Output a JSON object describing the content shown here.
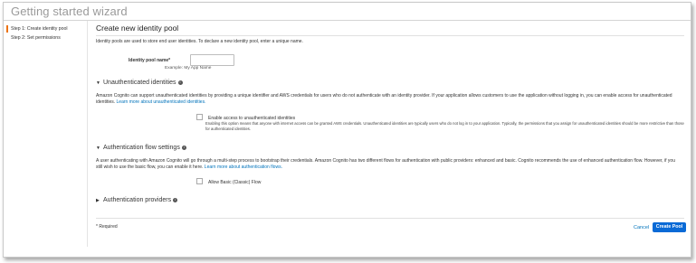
{
  "wizard_title": "Getting started wizard",
  "steps": [
    {
      "label": "Step 1: Create identity pool",
      "active": true
    },
    {
      "label": "Step 2: Set permissions",
      "active": false
    }
  ],
  "page_title": "Create new identity pool",
  "intro": "Identity pools are used to store end user identities. To declare a new identity pool, enter a unique name.",
  "pool_name": {
    "label": "Identity pool name*",
    "value": "",
    "example": "Example: My App Name"
  },
  "unauth": {
    "title": "Unauthenticated identities",
    "text": "Amazon Cognito can support unauthenticated identities by providing a unique identifier and AWS credentials for users who do not authenticate with an identity provider. If your application allows customers to use the application without logging in, you can enable access for unauthenticated identities.",
    "link": "Learn more about unauthenticated identities.",
    "checkbox_label": "Enable access to unauthenticated identities",
    "checked": false,
    "fine_print": "Enabling this option means that anyone with internet access can be granted AWS credentials. Unauthenticated identities are typically users who do not log in to your application. Typically, the permissions that you assign for unauthenticated identities should be more restrictive than those for authenticated identities."
  },
  "auth_flow": {
    "title": "Authentication flow settings",
    "text": "A user authenticating with Amazon Cognito will go through a multi-step process to bootstrap their credentials. Amazon Cognito has two different flows for authentication with public providers: enhanced and basic. Cognito recommends the use of enhanced authentication flow. However, if you still wish to use the basic flow, you can enable it here.",
    "link": "Learn more about authentication flows.",
    "checkbox_label": "Allow Basic (Classic) Flow",
    "checked": false
  },
  "auth_providers": {
    "title": "Authentication providers"
  },
  "footer": {
    "required_note": "* Required",
    "cancel_label": "Cancel",
    "create_label": "Create Pool"
  },
  "colors": {
    "accent_orange": "#ec7211",
    "link_blue": "#0073bb",
    "primary_button": "#0a6ad6"
  }
}
